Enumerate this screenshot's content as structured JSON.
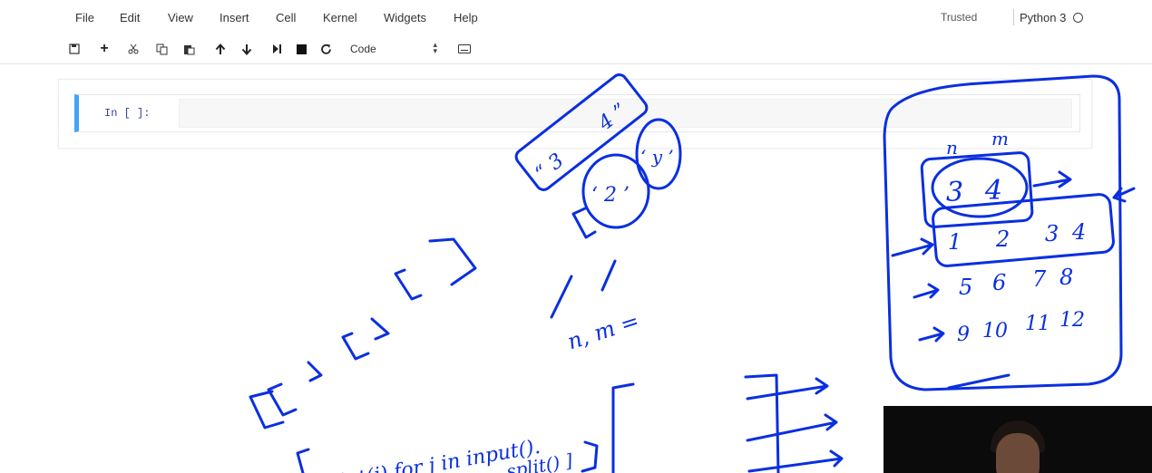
{
  "menu": {
    "items": [
      "File",
      "Edit",
      "View",
      "Insert",
      "Cell",
      "Kernel",
      "Widgets",
      "Help"
    ],
    "trusted": "Trusted",
    "kernel": "Python 3"
  },
  "toolbar": {
    "buttons": [
      "save-icon",
      "add-icon",
      "cut-icon",
      "copy-icon",
      "paste-icon",
      "move-up-icon",
      "move-down-icon",
      "run-icon",
      "stop-icon",
      "restart-icon"
    ],
    "cell_type": "Code",
    "keyboard": "keyboard-icon"
  },
  "cell": {
    "prompt": "In [ ]:",
    "code": ""
  },
  "annotations": {
    "matrix_header": [
      "n",
      "m"
    ],
    "matrix_first": [
      "3",
      "4"
    ],
    "matrix_rows": [
      [
        "1",
        "2",
        "3",
        "4"
      ],
      [
        "5",
        "6",
        "7",
        "8"
      ],
      [
        "9",
        "10",
        "11",
        "12"
      ]
    ],
    "string_box": [
      "“ 3",
      "4 ”"
    ],
    "split_items": [
      "‘ 2 ’",
      "‘ y ’"
    ],
    "assign": "n, m =",
    "brackets": "[[ ], [ ], [ ]]",
    "comprehension_line1": "[ int(j) for j in input().",
    "comprehension_line2": "split() ]"
  },
  "colors": {
    "accent": "#42a5f5",
    "ink": "#0a2fe0",
    "prompt": "#303f9f"
  }
}
